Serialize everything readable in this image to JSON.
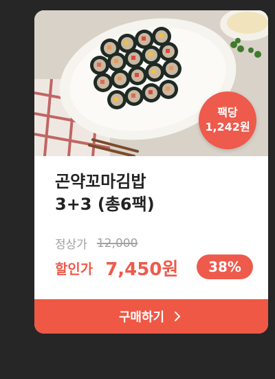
{
  "product": {
    "badge_line1": "팩당",
    "badge_line2": "1,242원",
    "title_line1": "곤약꼬마김밥",
    "title_line2": "3+3 (총6팩)",
    "original_label": "정상가",
    "original_price": "12,000",
    "sale_label": "할인가",
    "sale_price": "7,450원",
    "discount": "38%"
  },
  "actions": {
    "buy_label": "구매하기"
  },
  "colors": {
    "background": "#262626",
    "accent": "#ee5a4c",
    "button": "#ef5844"
  },
  "icons": {
    "buy_arrow": "chevron-right-icon"
  }
}
